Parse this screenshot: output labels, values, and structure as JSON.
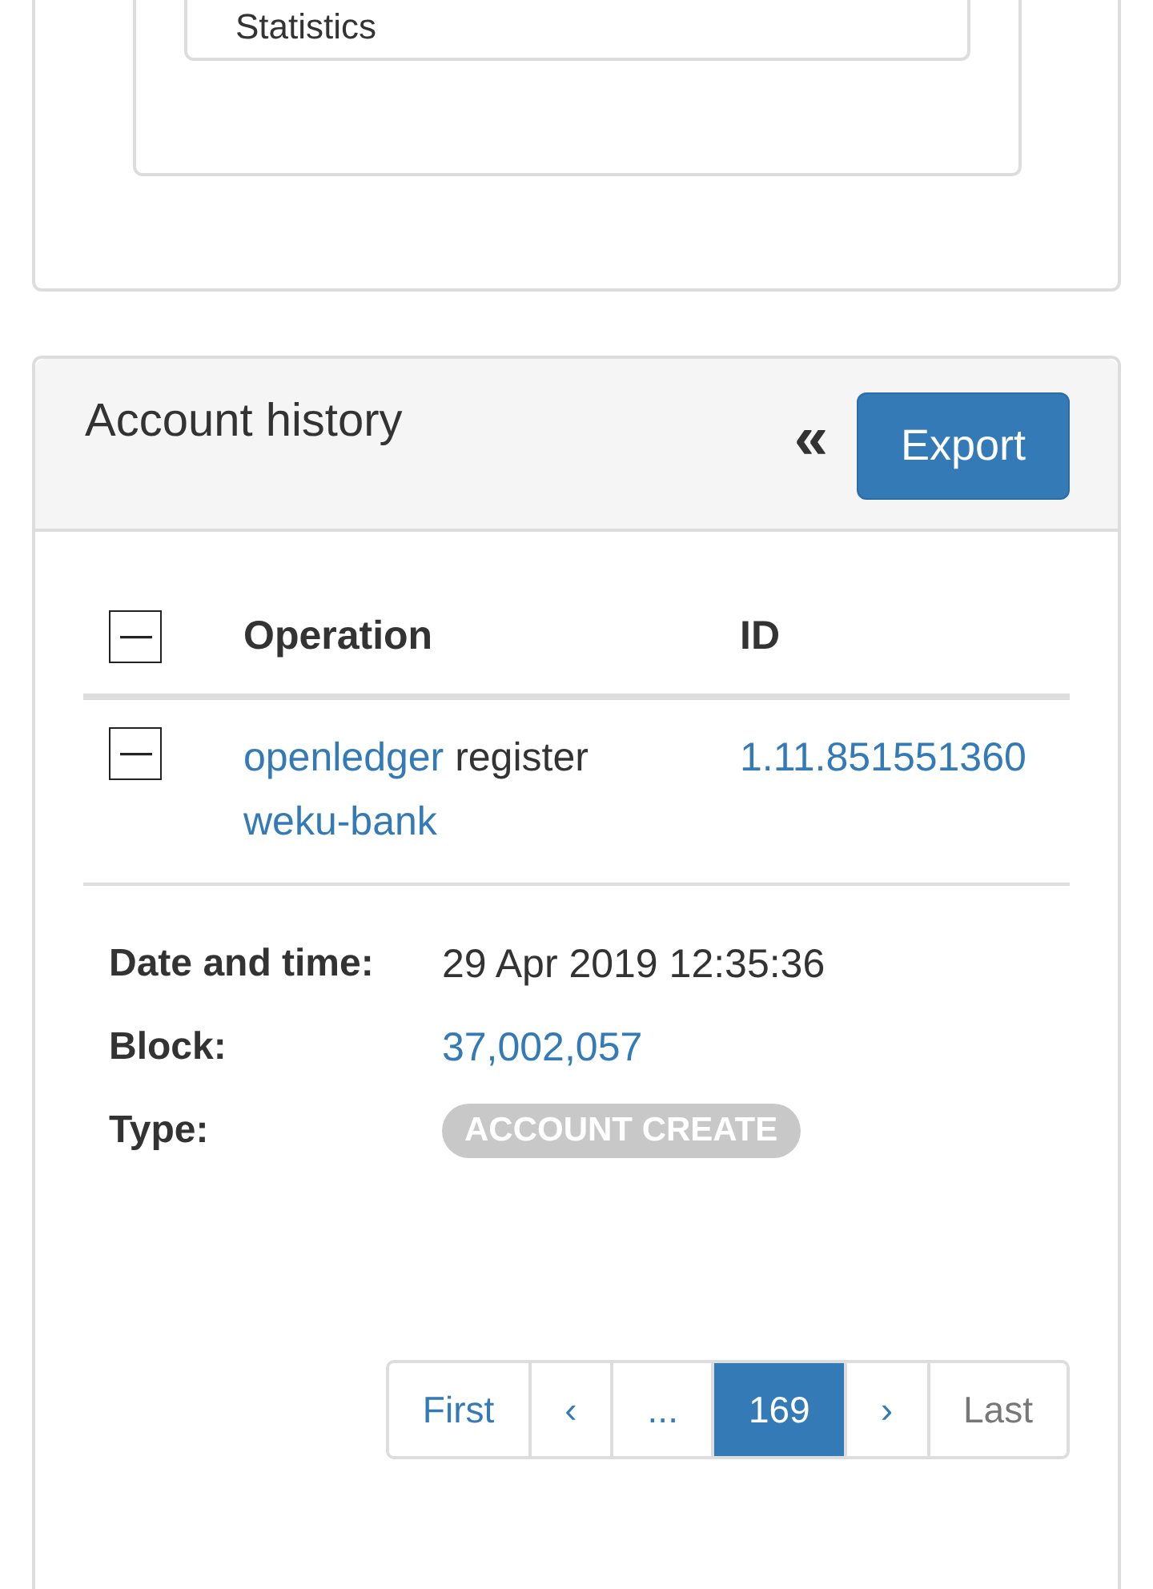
{
  "statistics_card": {
    "label": "Statistics"
  },
  "account_history": {
    "title": "Account history",
    "collapse_label": "«",
    "export_button": "Export",
    "header_toggle": {
      "expanded": true
    },
    "columns": [
      "Operation",
      "ID"
    ],
    "rows": [
      {
        "expanded": true,
        "operation": [
          {
            "text": "openledger",
            "link": true
          },
          {
            "text": "register",
            "link": false
          },
          {
            "text": "weku-bank",
            "link": true
          }
        ],
        "id": "1.11.851551360"
      }
    ],
    "details": [
      {
        "label": "Date and time:",
        "value": "29 Apr 2019 12:35:36",
        "kind": "text"
      },
      {
        "label": "Block:",
        "value": "37,002,057",
        "kind": "link"
      },
      {
        "label": "Type:",
        "value": "ACCOUNT CREATE",
        "kind": "badge"
      }
    ],
    "pagination": [
      {
        "label": "First",
        "selected": false,
        "disabled": false
      },
      {
        "label": "‹",
        "selected": false,
        "disabled": false
      },
      {
        "label": "...",
        "selected": false,
        "disabled": false
      },
      {
        "label": "169",
        "selected": true,
        "disabled": false
      },
      {
        "label": "›",
        "selected": false,
        "disabled": false
      },
      {
        "label": "Last",
        "selected": false,
        "disabled": true
      }
    ]
  }
}
